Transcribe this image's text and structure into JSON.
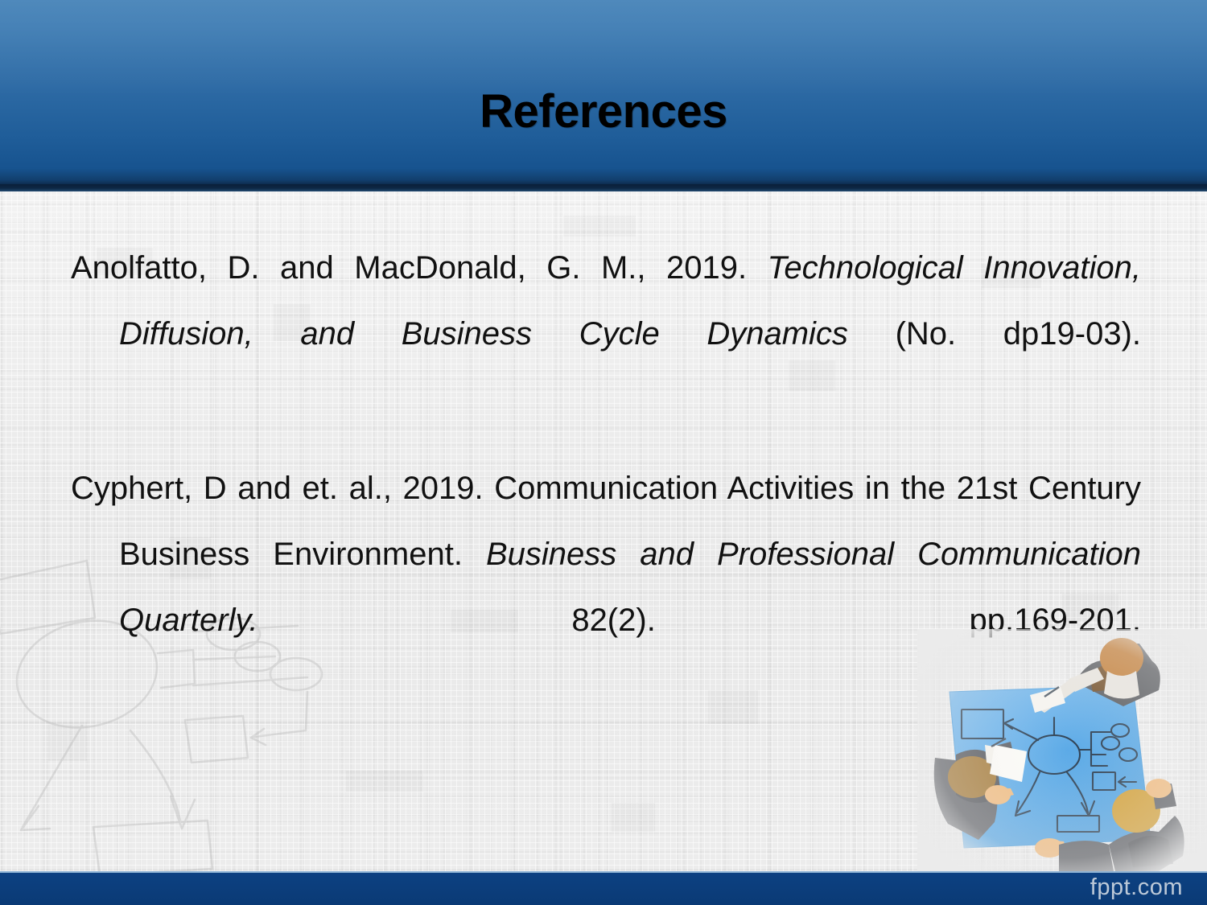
{
  "slide": {
    "title": "References",
    "header_color": "#2f6ca6",
    "header_accent_color": "#0c2340",
    "body_bg_color": "#ebebeb",
    "footer_color": "#0d4182",
    "text_color": "#111111"
  },
  "references": [
    {
      "id": "reference-1",
      "parts": [
        {
          "text": "Anolfatto, D. and MacDonald, G. M., 2019. ",
          "style": "regular"
        },
        {
          "text": "Technological Innovation, Diffusion, and Business Cycle Dynamics",
          "style": "italic"
        },
        {
          "text": " (No. dp19-03).",
          "style": "regular"
        }
      ],
      "plain": "Anolfatto, D. and MacDonald, G. M., 2019. Technological Innovation, Diffusion, and Business Cycle Dynamics (No. dp19-03)."
    },
    {
      "id": "reference-2",
      "parts": [
        {
          "text": "Cyphert, D and et. al., 2019. Communication Activities in the 21st Century Business Environment. ",
          "style": "regular"
        },
        {
          "text": "Business and Professional Communication Quarterly.",
          "style": "italic"
        },
        {
          "text": " 82(2). pp.169-201.",
          "style": "regular"
        }
      ],
      "plain": "Cyphert, D and et. al., 2019. Communication Activities in the 21st Century Business Environment. Business and Professional Communication Quarterly. 82(2). pp.169-201."
    }
  ],
  "footer": {
    "logo_text": "fppt.com"
  },
  "decorations": {
    "watermark_sketch": "flowchart-sketch-watermark",
    "photo": "team-meeting-overhead-illustration"
  }
}
